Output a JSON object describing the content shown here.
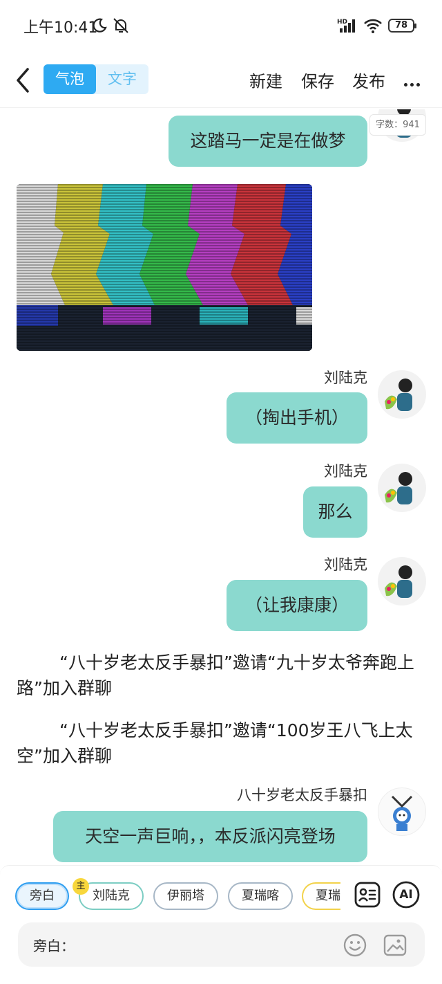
{
  "status_bar": {
    "time": "上午10:41",
    "battery": "78",
    "icons": [
      "moon-icon",
      "bell-off-icon",
      "hd-signal-icon",
      "wifi-icon",
      "battery-icon"
    ]
  },
  "header": {
    "tabs": [
      {
        "label": "气泡",
        "active": true
      },
      {
        "label": "文字",
        "active": false
      }
    ],
    "actions": {
      "new": "新建",
      "save": "保存",
      "publish": "发布"
    }
  },
  "word_count": "字数：941",
  "messages": {
    "m1": {
      "text": "这踏马一定是在做梦"
    },
    "m2": {
      "name": "刘陆克",
      "text": "（掏出手机）"
    },
    "m3": {
      "name": "刘陆克",
      "text": "那么"
    },
    "m4": {
      "name": "刘陆克",
      "text": "（让我康康）"
    },
    "sys1": "“八十岁老太反手暴扣”邀请“九十岁太爷奔跑上路”加入群聊",
    "sys2": "“八十岁老太反手暴扣”邀请“100岁王八飞上太空”加入群聊",
    "m5": {
      "name": "八十岁老太反手暴扣",
      "text": "天空一声巨响，，本反派闪亮登场"
    }
  },
  "bottom": {
    "characters": [
      {
        "label": "旁白",
        "active": true
      },
      {
        "label": "刘陆克",
        "badge": "主"
      },
      {
        "label": "伊丽塔"
      },
      {
        "label": "夏瑞喀"
      },
      {
        "label": "夏瑞"
      }
    ],
    "ai_label": "AI",
    "input_label": "旁白："
  },
  "colors": {
    "accent": "#2eaaf2",
    "bubble": "#8bd9cf",
    "badge": "#f8d73c"
  }
}
